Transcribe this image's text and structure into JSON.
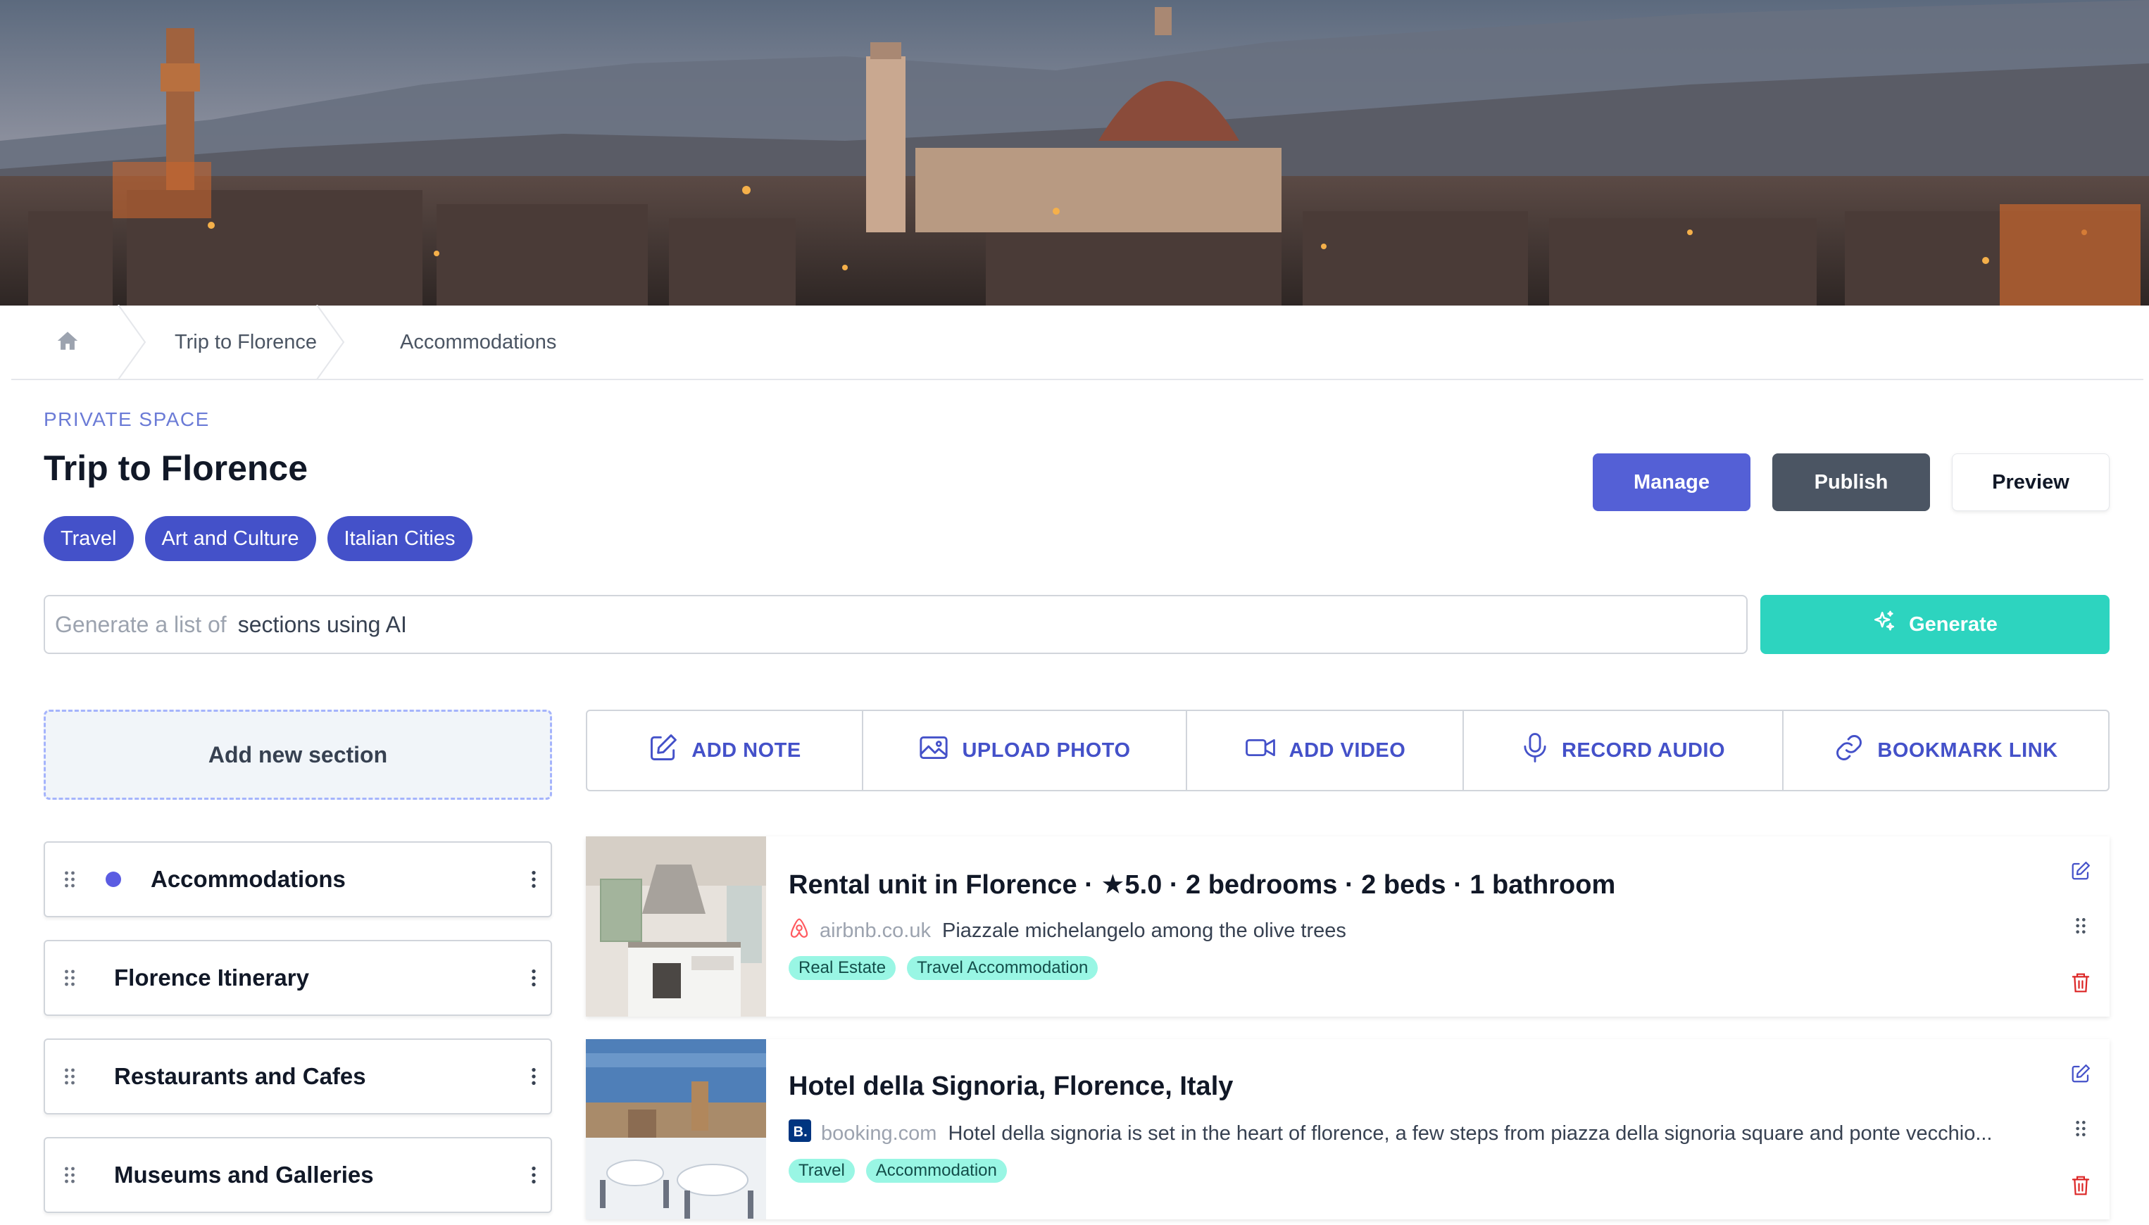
{
  "breadcrumb": {
    "home_icon": "home-icon",
    "items": [
      "Trip to Florence",
      "Accommodations"
    ]
  },
  "header": {
    "space_label": "PRIVATE SPACE",
    "title": "Trip to Florence",
    "tags": [
      "Travel",
      "Art and Culture",
      "Italian Cities"
    ],
    "buttons": {
      "manage": "Manage",
      "publish": "Publish",
      "preview": "Preview"
    }
  },
  "ai": {
    "prefix": "Generate a list of",
    "value": "sections using AI",
    "generate_label": "Generate",
    "generate_icon": "sparkles-icon"
  },
  "sidebar": {
    "add_section_label": "Add new section",
    "sections": [
      {
        "label": "Accommodations",
        "active": true
      },
      {
        "label": "Florence Itinerary",
        "active": false
      },
      {
        "label": "Restaurants and Cafes",
        "active": false
      },
      {
        "label": "Museums and Galleries",
        "active": false
      }
    ]
  },
  "toolbar": {
    "items": [
      {
        "label": "ADD NOTE",
        "icon": "edit-note-icon"
      },
      {
        "label": "UPLOAD PHOTO",
        "icon": "image-icon"
      },
      {
        "label": "ADD VIDEO",
        "icon": "video-icon"
      },
      {
        "label": "RECORD AUDIO",
        "icon": "microphone-icon"
      },
      {
        "label": "BOOKMARK LINK",
        "icon": "link-icon"
      }
    ]
  },
  "cards": [
    {
      "title": "Rental unit in Florence · ★5.0 · 2 bedrooms · 2 beds · 1 bathroom",
      "source_icon": "airbnb-logo-icon",
      "domain": "airbnb.co.uk",
      "description": "Piazzale michelangelo among the olive trees",
      "tags": [
        "Real Estate",
        "Travel Accommodation"
      ]
    },
    {
      "title": "Hotel della Signoria, Florence, Italy",
      "source_icon": "booking-logo-icon",
      "domain": "booking.com",
      "description": "Hotel della signoria is set in the heart of florence, a few steps from piazza della signoria square and ponte vecchio...",
      "tags": [
        "Travel",
        "Accommodation"
      ]
    }
  ],
  "colors": {
    "primary": "#4451c9",
    "manage": "#5460d6",
    "publish": "#4b5563",
    "generate": "#2dd4bf",
    "tag_pill": "#99f6e4",
    "delete": "#dc2626",
    "active_dot": "#5b5ce2"
  }
}
